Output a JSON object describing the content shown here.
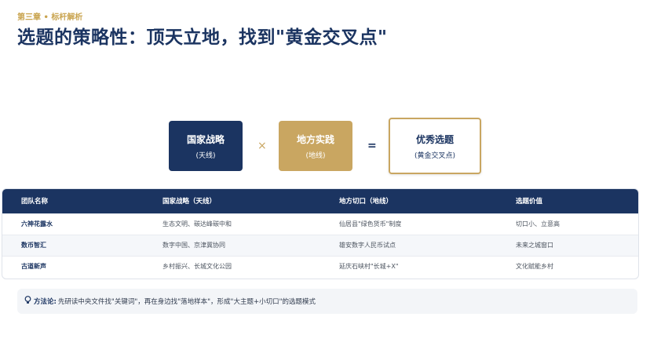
{
  "header": {
    "chapter": "第三章 • 标杆解析",
    "title": "选题的策略性：顶天立地，找到\"黄金交叉点\""
  },
  "formula": {
    "national": {
      "main": "国家战略",
      "sub": "(天线)"
    },
    "times": "×",
    "local": {
      "main": "地方实践",
      "sub": "(地线)"
    },
    "equals": "=",
    "result": {
      "main": "优秀选题",
      "sub": "(黄金交叉点)"
    }
  },
  "table": {
    "headers": [
      "团队名称",
      "国家战略（天线）",
      "地方切口（地线）",
      "选题价值"
    ],
    "rows": [
      {
        "team": "六神花露水",
        "national": "生态文明、碳达峰碳中和",
        "local": "仙居县\"绿色货币\"制度",
        "value": "切口小、立意高"
      },
      {
        "team": "数币智汇",
        "national": "数字中国、京津冀协同",
        "local": "雄安数字人民币试点",
        "value": "未来之城窗口"
      },
      {
        "team": "古道新声",
        "national": "乡村振兴、长城文化公园",
        "local": "延庆石峡村\"长城+X\"",
        "value": "文化赋能乡村"
      }
    ]
  },
  "method": {
    "icon": "lightbulb-icon",
    "label": "方法论:",
    "text": "先研读中央文件找\"关键词\"，再在身边找\"落地样本\"，形成\"大主题+小切口\"的选题模式"
  },
  "colors": {
    "navy": "#1b3461",
    "gold": "#c9a661"
  }
}
